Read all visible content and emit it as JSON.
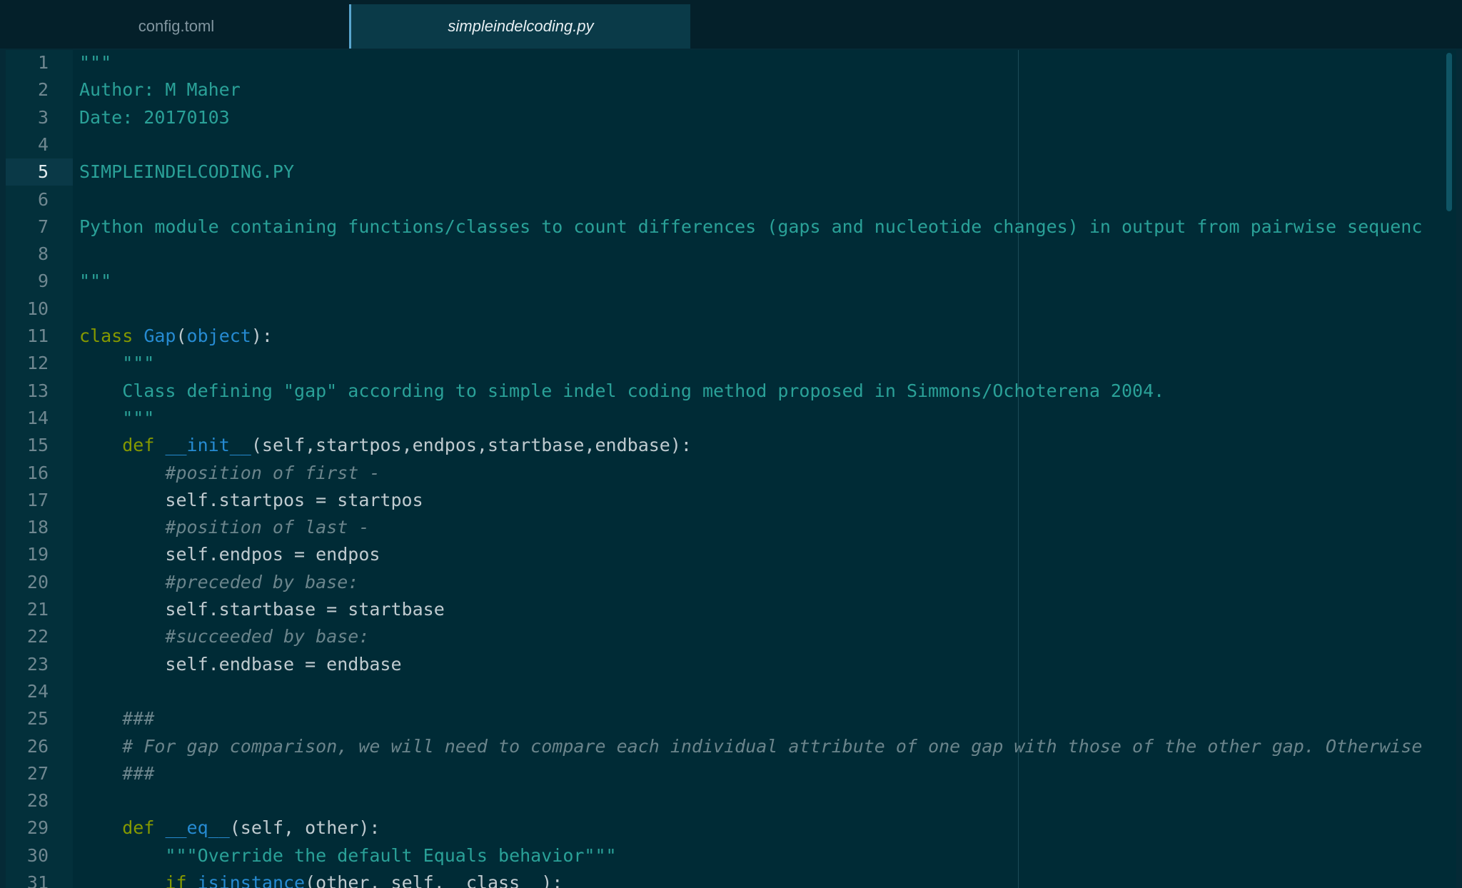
{
  "tabs": [
    {
      "label": "config.toml",
      "active": false
    },
    {
      "label": "simpleindelcoding.py",
      "active": true
    }
  ],
  "editor": {
    "current_line": 5,
    "line_numbers": [
      "1",
      "2",
      "3",
      "4",
      "5",
      "6",
      "7",
      "8",
      "9",
      "10",
      "11",
      "12",
      "13",
      "14",
      "15",
      "16",
      "17",
      "18",
      "19",
      "20",
      "21",
      "22",
      "23",
      "24",
      "25",
      "26",
      "27",
      "28",
      "29",
      "30",
      "31"
    ],
    "lines": [
      [
        {
          "t": "\"\"\"",
          "c": "doc"
        }
      ],
      [
        {
          "t": "Author: M Maher",
          "c": "doc"
        }
      ],
      [
        {
          "t": "Date: 20170103",
          "c": "doc"
        }
      ],
      [],
      [
        {
          "t": "SIMPLEINDELCODING.PY",
          "c": "doc"
        }
      ],
      [],
      [
        {
          "t": "Python module containing functions/classes to count differences (gaps and nucleotide changes) in output from pairwise sequenc",
          "c": "doc"
        }
      ],
      [],
      [
        {
          "t": "\"\"\"",
          "c": "doc"
        }
      ],
      [],
      [
        {
          "t": "class",
          "c": "kw"
        },
        {
          "t": " ",
          "c": "pl"
        },
        {
          "t": "Gap",
          "c": "fn"
        },
        {
          "t": "(",
          "c": "pl"
        },
        {
          "t": "object",
          "c": "fn"
        },
        {
          "t": "):",
          "c": "pl"
        }
      ],
      [
        {
          "t": "    \"\"\"",
          "c": "doc"
        }
      ],
      [
        {
          "t": "    Class defining \"gap\" according to simple indel coding method proposed in Simmons/Ochoterena 2004.",
          "c": "doc"
        }
      ],
      [
        {
          "t": "    \"\"\"",
          "c": "doc"
        }
      ],
      [
        {
          "t": "    ",
          "c": "pl"
        },
        {
          "t": "def",
          "c": "kw"
        },
        {
          "t": " ",
          "c": "pl"
        },
        {
          "t": "__init__",
          "c": "fn"
        },
        {
          "t": "(self,startpos,endpos,startbase,endbase):",
          "c": "pl"
        }
      ],
      [
        {
          "t": "        ",
          "c": "pl"
        },
        {
          "t": "#position of first -",
          "c": "cm"
        }
      ],
      [
        {
          "t": "        self.startpos = startpos",
          "c": "pl"
        }
      ],
      [
        {
          "t": "        ",
          "c": "pl"
        },
        {
          "t": "#position of last -",
          "c": "cm"
        }
      ],
      [
        {
          "t": "        self.endpos = endpos",
          "c": "pl"
        }
      ],
      [
        {
          "t": "        ",
          "c": "pl"
        },
        {
          "t": "#preceded by base:",
          "c": "cm"
        }
      ],
      [
        {
          "t": "        self.startbase = startbase",
          "c": "pl"
        }
      ],
      [
        {
          "t": "        ",
          "c": "pl"
        },
        {
          "t": "#succeeded by base:",
          "c": "cm"
        }
      ],
      [
        {
          "t": "        self.endbase = endbase",
          "c": "pl"
        }
      ],
      [],
      [
        {
          "t": "    ",
          "c": "pl"
        },
        {
          "t": "###",
          "c": "cm"
        }
      ],
      [
        {
          "t": "    ",
          "c": "pl"
        },
        {
          "t": "# For gap comparison, we will need to compare each individual attribute of one gap with those of the other gap. Otherwise",
          "c": "cm"
        }
      ],
      [
        {
          "t": "    ",
          "c": "pl"
        },
        {
          "t": "###",
          "c": "cm"
        }
      ],
      [],
      [
        {
          "t": "    ",
          "c": "pl"
        },
        {
          "t": "def",
          "c": "kw"
        },
        {
          "t": " ",
          "c": "pl"
        },
        {
          "t": "__eq__",
          "c": "fn"
        },
        {
          "t": "(self, other):",
          "c": "pl"
        }
      ],
      [
        {
          "t": "        ",
          "c": "pl"
        },
        {
          "t": "\"\"\"Override the default Equals behavior\"\"\"",
          "c": "doc"
        }
      ],
      [
        {
          "t": "        ",
          "c": "pl"
        },
        {
          "t": "if",
          "c": "kw"
        },
        {
          "t": " ",
          "c": "pl"
        },
        {
          "t": "isinstance",
          "c": "fn"
        },
        {
          "t": "(other, self.__class__):",
          "c": "pl"
        }
      ]
    ]
  }
}
